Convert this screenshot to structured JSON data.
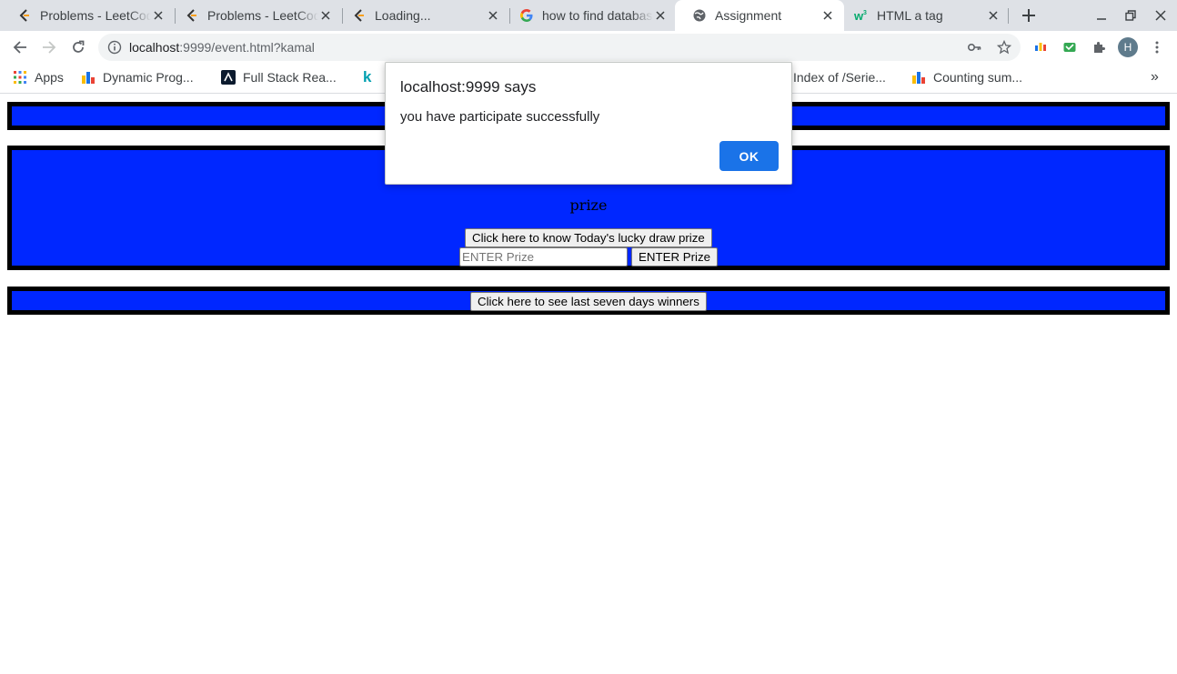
{
  "browser": {
    "tabs": [
      {
        "title": "Problems - LeetCode",
        "icon": "leetcode-icon"
      },
      {
        "title": "Problems - LeetCode",
        "icon": "leetcode-icon"
      },
      {
        "title": "Loading...",
        "icon": "leetcode-icon"
      },
      {
        "title": "how to find database",
        "icon": "google-icon"
      },
      {
        "title": "Assignment",
        "icon": "globe-icon",
        "active": true
      },
      {
        "title": "HTML a tag",
        "icon": "w3schools-icon"
      }
    ],
    "url_host": "localhost",
    "url_rest": ":9999/event.html?kamal",
    "profile_initial": "H",
    "bookmarks": [
      {
        "label": "Apps",
        "icon": "apps-grid-icon"
      },
      {
        "label": "Dynamic Prog...",
        "icon": "bar-chart-icon"
      },
      {
        "label": "Full Stack Rea...",
        "icon": "fullstack-icon"
      },
      {
        "label": "k",
        "icon": "k-icon"
      },
      {
        "label": "Index of /Serie...",
        "icon": ""
      },
      {
        "label": "Counting sum...",
        "icon": "bar-chart-icon"
      }
    ],
    "bookmarks_overflow": "»"
  },
  "page": {
    "prize_label": "prize",
    "lucky_draw_button": "Click here to know Today's lucky draw prize",
    "prize_input_placeholder": "ENTER Prize",
    "enter_prize_button": "ENTER Prize",
    "winners_button": "Click here to see last seven days winners",
    "box_color": "#0027ff"
  },
  "dialog": {
    "title": "localhost:9999 says",
    "message": "you have participate successfully",
    "ok_label": "OK",
    "ok_color": "#1a73e8"
  }
}
